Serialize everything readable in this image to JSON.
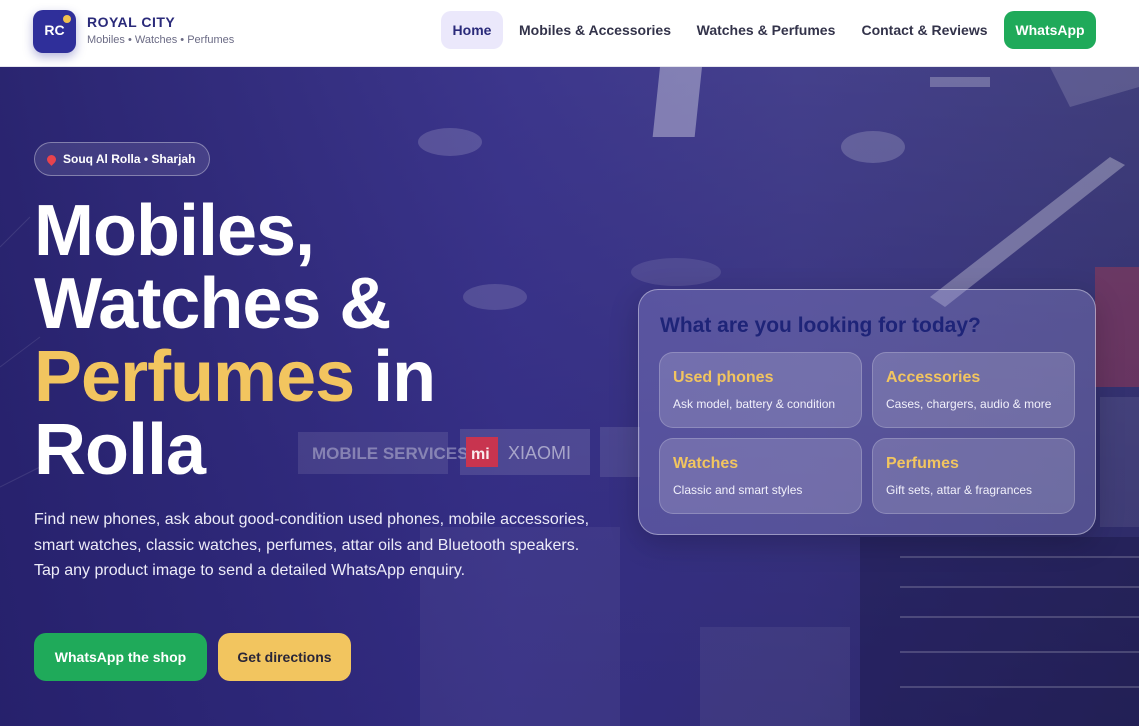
{
  "brand": {
    "logo_text": "RC",
    "name": "ROYAL CITY",
    "tagline": "Mobiles • Watches • Perfumes"
  },
  "nav": {
    "home": "Home",
    "mobiles": "Mobiles & Accessories",
    "watches": "Watches & Perfumes",
    "contact": "Contact & Reviews",
    "whatsapp": "WhatsApp"
  },
  "hero": {
    "location": "Souq Al Rolla • Sharjah",
    "title_line1": "Mobiles,",
    "title_line2": "Watches &",
    "title_accent": "Perfumes",
    "title_in": " in",
    "title_line4": "Rolla",
    "description": "Find new phones, ask about good-condition used phones, mobile accessories, smart watches, classic watches, perfumes, attar oils and Bluetooth speakers. Tap any product image to send a detailed WhatsApp enquiry.",
    "cta_whatsapp": "WhatsApp the shop",
    "cta_directions": "Get directions"
  },
  "panel": {
    "title": "What are you looking for today?",
    "tiles": [
      {
        "title": "Used phones",
        "subtitle": "Ask model, battery & condition"
      },
      {
        "title": "Accessories",
        "subtitle": "Cases, chargers, audio & more"
      },
      {
        "title": "Watches",
        "subtitle": "Classic and smart styles"
      },
      {
        "title": "Perfumes",
        "subtitle": "Gift sets, attar & fragrances"
      }
    ]
  },
  "background_signs": {
    "sign1": "MOBILE SERVICES",
    "sign2": "mi",
    "sign3": "XIAOMI"
  },
  "colors": {
    "primary": "#2f2f9a",
    "accent": "#f2c55f",
    "whatsapp_green": "#1faa5a",
    "hero_overlay": "#342c8c"
  }
}
